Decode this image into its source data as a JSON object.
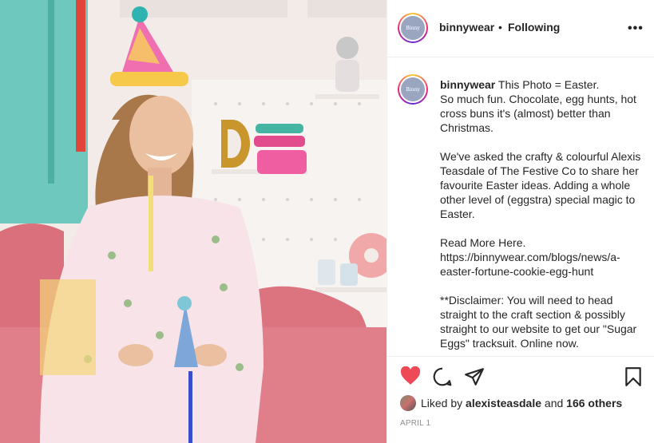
{
  "post": {
    "username": "binnywear",
    "follow_sep": "•",
    "follow_status": "Following",
    "more_icon": "more-horizontal-icon",
    "avatar_text": "Binny"
  },
  "caption": {
    "username": "binnywear",
    "line1": "This Photo = Easter.",
    "para1": "So much fun. Chocolate, egg hunts, hot cross buns it's (almost) better than Christmas.",
    "para2": "We've asked the crafty & colourful Alexis Teasdale of The Festive Co to share her favourite Easter ideas. Adding a whole other level of (eggstra) special magic to Easter.",
    "para3": "Read More Here. https://binnywear.com/blogs/news/a-easter-fortune-cookie-egg-hunt",
    "para4": "**Disclaimer: You will need to head straight to the craft section & possibly straight to our website to get our \"Sugar Eggs\" tracksuit. Online now."
  },
  "actions": {
    "like_icon": "heart-filled-icon",
    "comment_icon": "comment-icon",
    "share_icon": "share-icon",
    "save_icon": "bookmark-icon",
    "like_color": "#ed4956"
  },
  "likes": {
    "prefix": "Liked by",
    "user": "alexisteasdale",
    "conj": "and",
    "others": "166 others"
  },
  "date": "APRIL 1"
}
